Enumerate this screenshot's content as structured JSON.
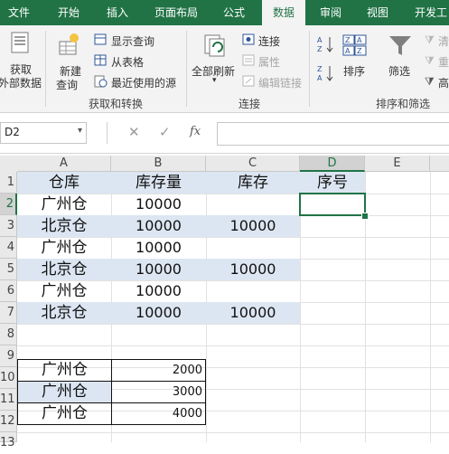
{
  "tabs": [
    {
      "label": "文件",
      "active": false
    },
    {
      "label": "开始",
      "active": false
    },
    {
      "label": "插入",
      "active": false
    },
    {
      "label": "页面布局",
      "active": false
    },
    {
      "label": "公式",
      "active": false
    },
    {
      "label": "数据",
      "active": true
    },
    {
      "label": "审阅",
      "active": false
    },
    {
      "label": "视图",
      "active": false
    },
    {
      "label": "开发工",
      "active": false
    }
  ],
  "ribbon": {
    "get_external_data_line1": "获取",
    "get_external_data_line2": "外部数据",
    "new_query_line1": "新建",
    "new_query_line2": "查询",
    "show_queries": "显示查询",
    "from_table": "从表格",
    "recent_sources": "最近使用的源",
    "group_get_transform": "获取和转换",
    "refresh_all": "全部刷新",
    "connections": "连接",
    "properties": "属性",
    "edit_links": "编辑链接",
    "group_connections": "连接",
    "sort": "排序",
    "filter": "筛选",
    "clear": "清",
    "reapply": "重",
    "advanced": "高",
    "group_sort_filter": "排序和筛选"
  },
  "formula_bar": {
    "name_box": "D2",
    "cancel_icon": "✕",
    "enter_icon": "✓",
    "fx": "fx",
    "formula": ""
  },
  "grid": {
    "columns": [
      "A",
      "B",
      "C",
      "D",
      "E"
    ],
    "rows": [
      "1",
      "2",
      "3",
      "4",
      "5",
      "6",
      "7",
      "8",
      "9",
      "10",
      "11",
      "12",
      "13"
    ],
    "header_row": {
      "a": "仓库",
      "b": "库存量",
      "c": "库存",
      "d": "序号"
    },
    "data_rows": [
      {
        "a": "广州仓",
        "b": "10000",
        "c": ""
      },
      {
        "a": "北京仓",
        "b": "10000",
        "c": "10000"
      },
      {
        "a": "广州仓",
        "b": "10000",
        "c": ""
      },
      {
        "a": "北京仓",
        "b": "10000",
        "c": "10000"
      },
      {
        "a": "广州仓",
        "b": "10000",
        "c": ""
      },
      {
        "a": "北京仓",
        "b": "10000",
        "c": "10000"
      }
    ],
    "lower_rows": [
      {
        "a": "广州仓",
        "b": "2000"
      },
      {
        "a": "广州仓",
        "b": "3000"
      },
      {
        "a": "广州仓",
        "b": "4000"
      }
    ]
  },
  "colors": {
    "accent": "#217346",
    "cell_fill": "#dce6f2"
  }
}
